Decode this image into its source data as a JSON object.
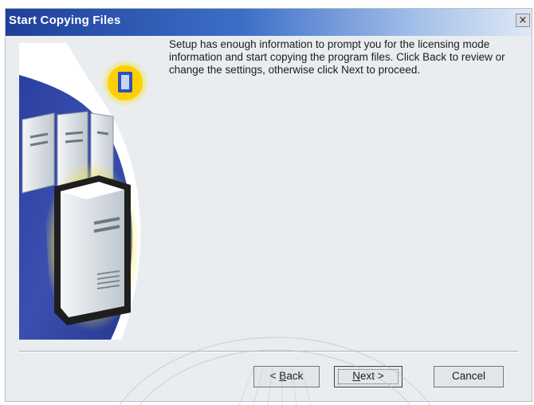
{
  "window": {
    "title": "Start Copying Files",
    "close_glyph": "×"
  },
  "content": {
    "message": "Setup has enough information to prompt you for the licensing mode information and start copying the program files.  Click Back to review or change the settings, otherwise click Next to proceed."
  },
  "buttons": {
    "back": {
      "prefix": "< ",
      "mnemonic": "B",
      "rest": "ack"
    },
    "next": {
      "mnemonic": "N",
      "rest": "ext >"
    },
    "cancel": "Cancel"
  },
  "icons": {
    "side_image": "server-computers-illustration",
    "badge": "setup-book-icon"
  },
  "colors": {
    "title_bar_start": "#1f3f9a",
    "panel_blue": "#2d3e96",
    "glow_yellow": "#f4e23a"
  }
}
